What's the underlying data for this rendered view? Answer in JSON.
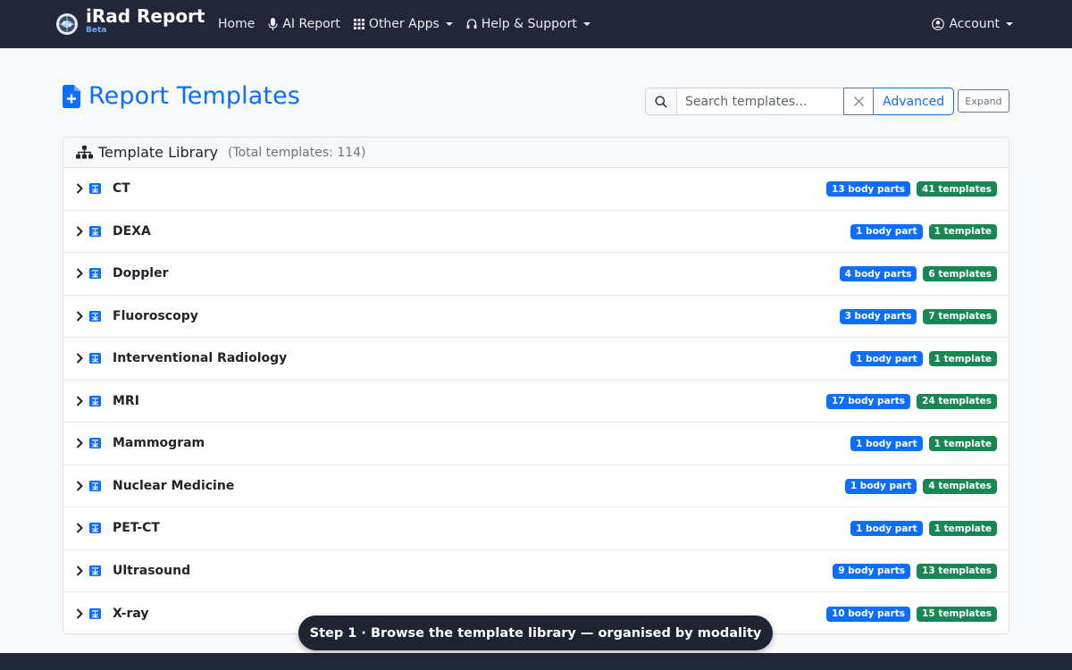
{
  "nav": {
    "brand_title": "iRad Report",
    "brand_sub": "Beta",
    "links": [
      {
        "label": "Home",
        "icon": "none"
      },
      {
        "label": "AI Report",
        "icon": "microphone-icon"
      },
      {
        "label": "Other Apps",
        "icon": "grid-icon",
        "dropdown": true
      },
      {
        "label": "Help & Support",
        "icon": "headset-icon",
        "dropdown": true
      }
    ],
    "account_label": "Account"
  },
  "header": {
    "title": "Report Templates",
    "search_placeholder": "Search templates...",
    "advanced_label": "Advanced",
    "expand_label": "Expand"
  },
  "library": {
    "title": "Template Library",
    "count_text": "(Total templates: 114)",
    "rows": [
      {
        "label": "CT",
        "parts": "13 body parts",
        "templates": "41 templates"
      },
      {
        "label": "DEXA",
        "parts": "1 body part",
        "templates": "1 template"
      },
      {
        "label": "Doppler",
        "parts": "4 body parts",
        "templates": "6 templates"
      },
      {
        "label": "Fluoroscopy",
        "parts": "3 body parts",
        "templates": "7 templates"
      },
      {
        "label": "Interventional Radiology",
        "parts": "1 body part",
        "templates": "1 template"
      },
      {
        "label": "MRI",
        "parts": "17 body parts",
        "templates": "24 templates"
      },
      {
        "label": "Mammogram",
        "parts": "1 body part",
        "templates": "1 template"
      },
      {
        "label": "Nuclear Medicine",
        "parts": "1 body part",
        "templates": "4 templates"
      },
      {
        "label": "PET-CT",
        "parts": "1 body part",
        "templates": "1 template"
      },
      {
        "label": "Ultrasound",
        "parts": "9 body parts",
        "templates": "13 templates"
      },
      {
        "label": "X-ray",
        "parts": "10 body parts",
        "templates": "15 templates"
      }
    ]
  },
  "tour": {
    "text": "Step 1 · Browse the template library — organised by modality"
  },
  "colors": {
    "navbar": "#212738",
    "primary": "#0d6efd",
    "success": "#198754"
  }
}
